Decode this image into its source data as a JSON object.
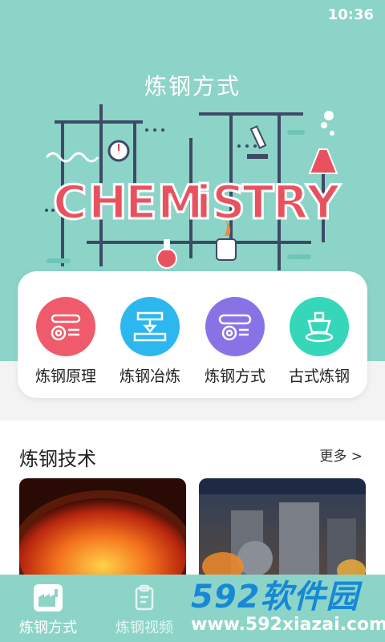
{
  "status_bar": {
    "time": "10:36"
  },
  "hero": {
    "title": "炼钢方式",
    "art_text": "CHEMISTRY"
  },
  "menu": [
    {
      "label": "炼钢原理",
      "icon": "conveyor-gear-icon",
      "color": "#ef5b6a"
    },
    {
      "label": "炼钢冶炼",
      "icon": "press-machine-icon",
      "color": "#2cb7ef"
    },
    {
      "label": "炼钢方式",
      "icon": "belt-machine-icon",
      "color": "#8873e6"
    },
    {
      "label": "古式炼钢",
      "icon": "smelter-icon",
      "color": "#36d7b8"
    }
  ],
  "section": {
    "title": "炼钢技术",
    "more": "更多 >"
  },
  "thumbnails": [
    {
      "name": "molten-furnace-image"
    },
    {
      "name": "steel-plant-image"
    }
  ],
  "tabbar": [
    {
      "label": "炼钢方式",
      "icon": "factory-icon",
      "active": true
    },
    {
      "label": "炼钢视频",
      "icon": "clipboard-icon",
      "active": false
    }
  ],
  "watermark": {
    "brand": "592软件园",
    "url": "www.592xiazai.com"
  }
}
